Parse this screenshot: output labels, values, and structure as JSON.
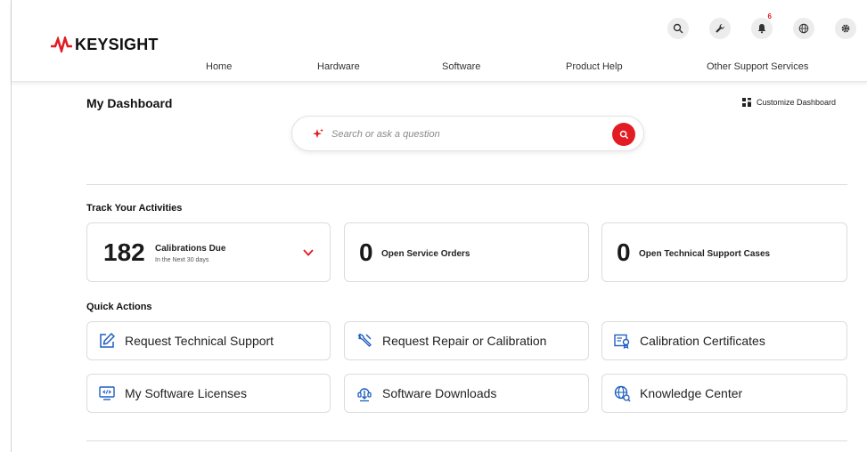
{
  "brand": {
    "name": "KEYSIGHT",
    "accent": "#e31b23"
  },
  "header": {
    "icons": [
      {
        "name": "search-icon"
      },
      {
        "name": "wrench-icon"
      },
      {
        "name": "bell-icon",
        "badge": "6"
      },
      {
        "name": "globe-icon"
      },
      {
        "name": "gear-icon"
      }
    ],
    "nav": [
      "Home",
      "Hardware",
      "Software",
      "Product Help",
      "Other Support Services"
    ]
  },
  "dashboard": {
    "title": "My Dashboard",
    "customize_label": "Customize Dashboard",
    "search": {
      "placeholder": "Search or ask a question"
    }
  },
  "activities": {
    "label": "Track Your Activities",
    "cards": [
      {
        "count": "182",
        "label": "Calibrations Due",
        "sub": "In the Next 30 days"
      },
      {
        "count": "0",
        "label": "Open Service Orders"
      },
      {
        "count": "0",
        "label": "Open Technical Support Cases"
      }
    ]
  },
  "quick_actions": {
    "label": "Quick Actions",
    "items": [
      {
        "label": "Request Technical Support",
        "icon": "edit-icon"
      },
      {
        "label": "Request Repair or Calibration",
        "icon": "tools-icon"
      },
      {
        "label": "Calibration Certificates",
        "icon": "certificate-icon"
      },
      {
        "label": "My Software Licenses",
        "icon": "license-icon"
      },
      {
        "label": "Software Downloads",
        "icon": "download-icon"
      },
      {
        "label": "Knowledge Center",
        "icon": "knowledge-icon"
      }
    ]
  }
}
